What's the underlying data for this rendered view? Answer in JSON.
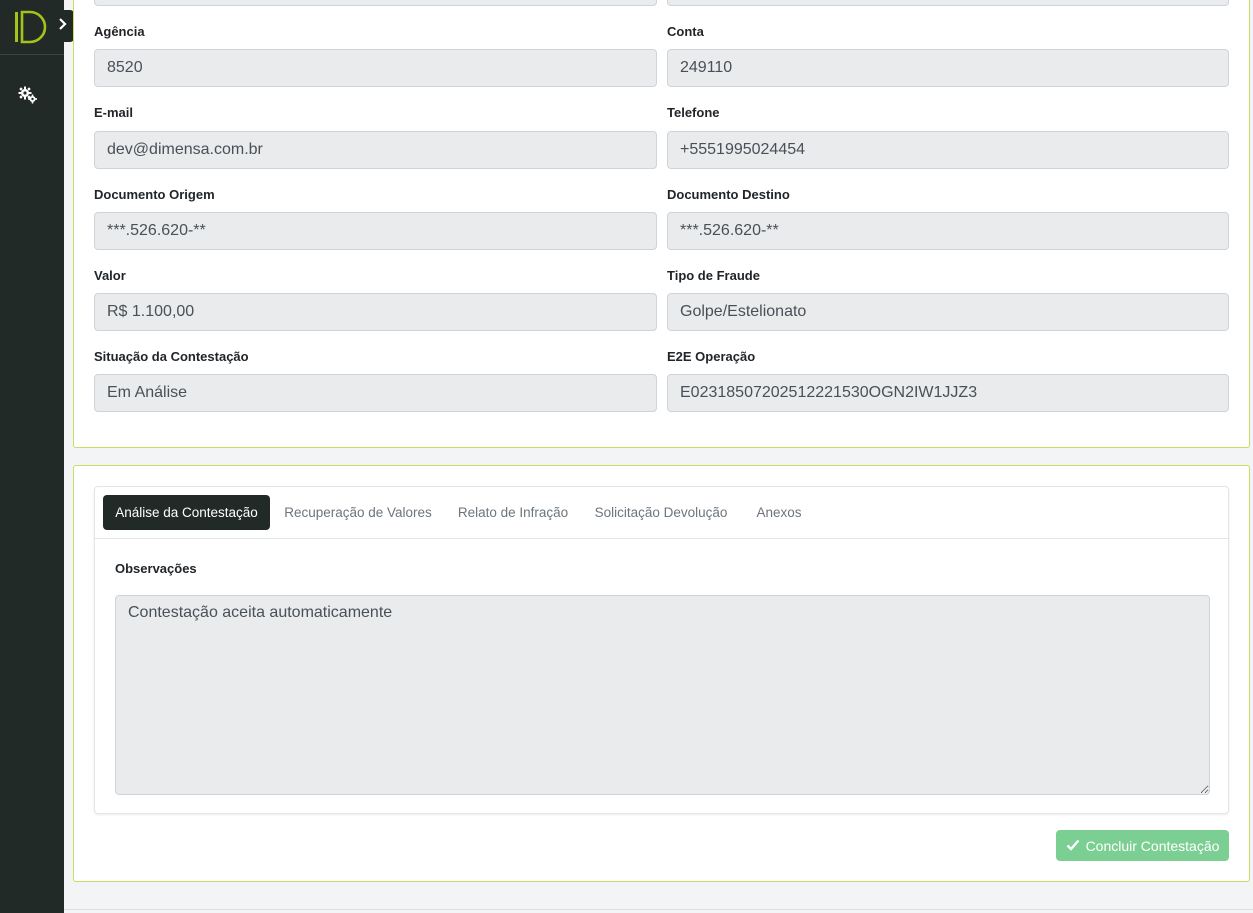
{
  "sidebar": {
    "logo_icon": "dimensa-logo-icon",
    "toggle_icon": "chevron-right-icon",
    "items": [
      {
        "icon": "gears-icon"
      }
    ],
    "brand_color": "#a3c31a"
  },
  "form": {
    "agencia": {
      "label": "Agência",
      "value": "8520"
    },
    "conta": {
      "label": "Conta",
      "value": "249110"
    },
    "email": {
      "label": "E-mail",
      "value": "dev@dimensa.com.br"
    },
    "telefone": {
      "label": "Telefone",
      "value": "+5551995024454"
    },
    "documento_origem": {
      "label": "Documento Origem",
      "value": "***.526.620-**"
    },
    "documento_destino": {
      "label": "Documento Destino",
      "value": "***.526.620-**"
    },
    "valor": {
      "label": "Valor",
      "value": "R$ 1.100,00"
    },
    "tipo_fraude": {
      "label": "Tipo de Fraude",
      "value": "Golpe/Estelionato"
    },
    "situacao": {
      "label": "Situação da Contestação",
      "value": "Em Análise"
    },
    "e2e": {
      "label": "E2E Operação",
      "value": "E02318507202512221530OGN2IW1JJZ3"
    }
  },
  "tabs": [
    {
      "label": "Análise da Contestação",
      "active": true
    },
    {
      "label": "Recuperação de Valores",
      "active": false
    },
    {
      "label": "Relato de Infração",
      "active": false
    },
    {
      "label": "Solicitação Devolução",
      "active": false
    },
    {
      "label": "Anexos",
      "active": false
    }
  ],
  "analysis": {
    "observacoes_label": "Observações",
    "observacoes_value": "Contestação aceita automaticamente"
  },
  "actions": {
    "conclude_label": "Concluir Contestação",
    "conclude_icon": "check-icon",
    "conclude_color": "#7ccf92"
  },
  "colors": {
    "card_border": "#c9dc63",
    "active_tab_bg": "#212a27"
  }
}
